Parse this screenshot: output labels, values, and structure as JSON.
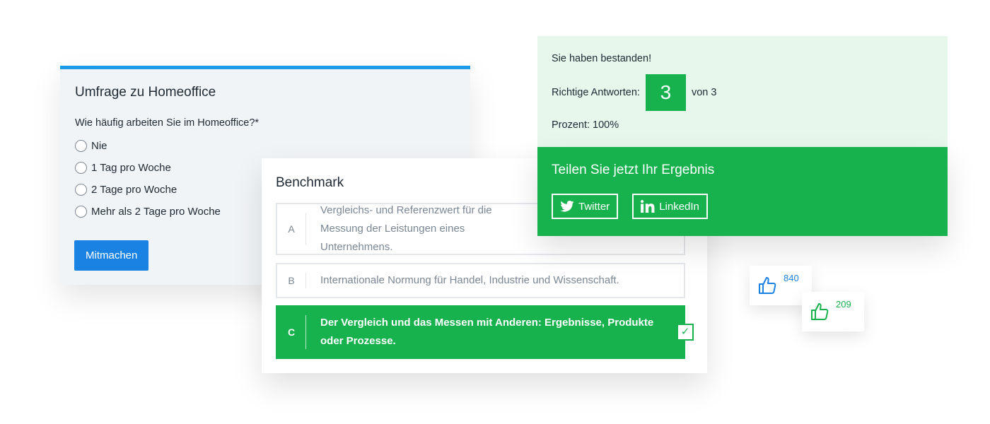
{
  "survey": {
    "title": "Umfrage zu Homeoffice",
    "question": "Wie häufig arbeiten Sie im Homeoffice?*",
    "options": [
      "Nie",
      "1 Tag pro Woche",
      "2 Tage pro Woche",
      "Mehr als 2 Tage pro Woche"
    ],
    "submit_label": "Mitmachen"
  },
  "benchmark": {
    "title": "Benchmark",
    "answers": [
      {
        "letter": "A",
        "text": "Vergleichs- und Referenzwert für die Messung der Leistungen eines Unternehmens.",
        "visible_text": "Vergleichs- und Referenzwert für die Messun"
      },
      {
        "letter": "B",
        "text": "Internationale Normung für Handel, Industrie und Wissenschaft."
      },
      {
        "letter": "C",
        "text": "Der Vergleich und das Messen mit Anderen: Ergebnisse, Produkte oder Prozesse.",
        "correct": true
      }
    ],
    "check_mark": "✓"
  },
  "result": {
    "passed_text": "Sie haben bestanden!",
    "correct_label": "Richtige Antworten:",
    "score": "3",
    "of_text": "von 3",
    "percent_text": "Prozent: 100%"
  },
  "share": {
    "title": "Teilen Sie jetzt Ihr Ergebnis",
    "twitter_label": "Twitter",
    "linkedin_label": "LinkedIn"
  },
  "likes": [
    {
      "count": "840",
      "color": "#1a82e2",
      "icon": "thumbs-up-icon"
    },
    {
      "count": "209",
      "color": "#17b24e",
      "icon": "thumbs-up-icon"
    }
  ],
  "colors": {
    "accent_blue": "#1b9ae6",
    "button_blue": "#1a82e2",
    "success_green": "#17b24e",
    "result_bg": "#e8f7ec"
  }
}
